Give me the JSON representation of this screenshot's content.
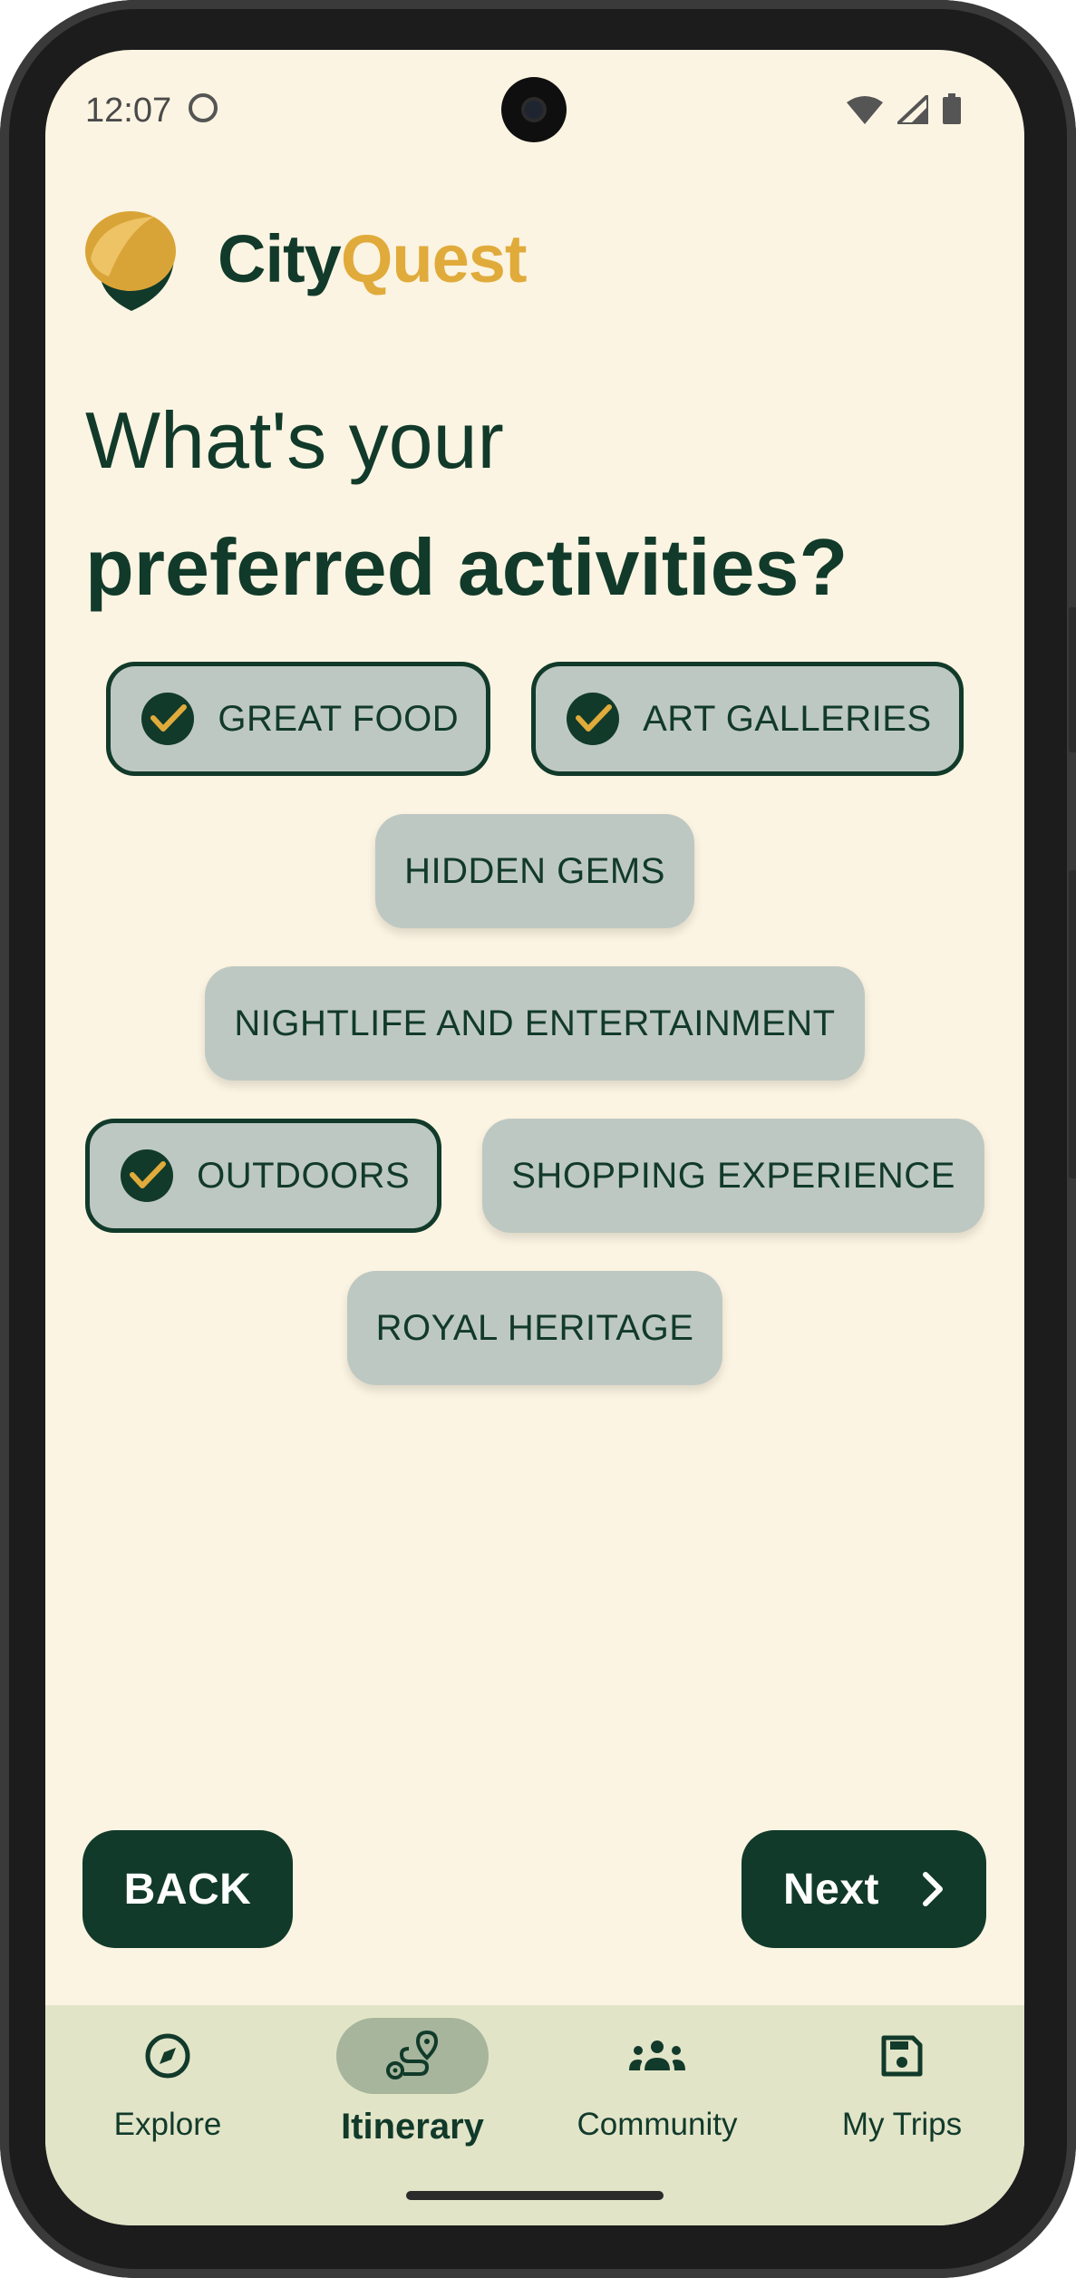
{
  "status_bar": {
    "time": "12:07"
  },
  "brand": {
    "part_a": "City",
    "part_b": "Quest",
    "color_dark": "#113a2a",
    "color_gold": "#e0ab3b"
  },
  "headline": {
    "line1": "What's your",
    "line2": "preferred activities?"
  },
  "activities": [
    {
      "label": "GREAT FOOD",
      "selected": true
    },
    {
      "label": "ART GALLERIES",
      "selected": true
    },
    {
      "label": "HIDDEN GEMS",
      "selected": false
    },
    {
      "label": "NIGHTLIFE AND ENTERTAINMENT",
      "selected": false
    },
    {
      "label": "OUTDOORS",
      "selected": true
    },
    {
      "label": "SHOPPING EXPERIENCE",
      "selected": false
    },
    {
      "label": "ROYAL HERITAGE",
      "selected": false
    }
  ],
  "buttons": {
    "back": "BACK",
    "next": "Next"
  },
  "nav": {
    "items": [
      {
        "label": "Explore",
        "icon": "compass-icon",
        "active": false
      },
      {
        "label": "Itinerary",
        "icon": "route-icon",
        "active": true
      },
      {
        "label": "Community",
        "icon": "groups-icon",
        "active": false
      },
      {
        "label": "My Trips",
        "icon": "save-icon",
        "active": false
      }
    ]
  },
  "colors": {
    "background": "#fcf4e2",
    "chip": "#bec8c2",
    "nav_bar": "#e2e4c8",
    "nav_active": "#a6b59c"
  }
}
